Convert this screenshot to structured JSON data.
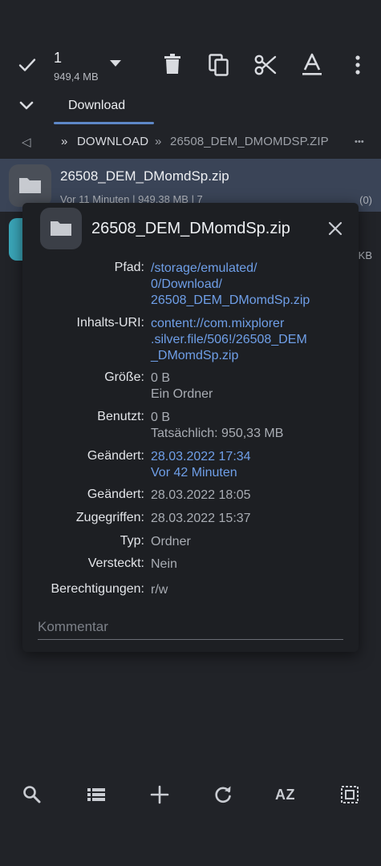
{
  "toolbar": {
    "selected_count": "1",
    "selected_size": "949,4 MB",
    "icons": [
      "check-icon",
      "dropdown-icon",
      "delete-icon",
      "copy-icon",
      "cut-icon",
      "rename-icon",
      "more-icon"
    ]
  },
  "tabs": [
    {
      "label": "Download",
      "active": true
    }
  ],
  "breadcrumb": {
    "back_symbol": "◁",
    "separator1": "»",
    "segment1": "DOWNLOAD",
    "separator2": "»",
    "segment2": "26508_DEM_DMOMDSP.ZIP",
    "overflow": "•••"
  },
  "file_list": {
    "items": [
      {
        "name": "26508_DEM_DMomdSp.zip",
        "meta": "Vor 11 Minuten | 949,38 MB | 7",
        "count": "(0)",
        "selected": true
      },
      {
        "size": "KB"
      }
    ]
  },
  "dialog": {
    "title": "26508_DEM_DMomdSp.zip",
    "rows": {
      "pfad": {
        "label": "Pfad:",
        "lines": [
          "/storage/emulated/",
          "0/Download/",
          "26508_DEM_DMomdSp.zip"
        ]
      },
      "uri": {
        "label": "Inhalts-URI:",
        "lines": [
          "content://com.mixplorer",
          ".silver.file/506!/26508_DEM",
          "_DMomdSp.zip"
        ]
      },
      "groesse": {
        "label": "Größe:",
        "lines": [
          "0 B",
          "Ein Ordner"
        ]
      },
      "benutzt": {
        "label": "Benutzt:",
        "lines": [
          "0 B",
          "Tatsächlich: 950,33 MB"
        ]
      },
      "geaendert1": {
        "label": "Geändert:",
        "lines": [
          "28.03.2022 17:34",
          "Vor 42 Minuten"
        ]
      },
      "geaendert2": {
        "label": "Geändert:",
        "value": "28.03.2022 18:05"
      },
      "zugegriffen": {
        "label": "Zugegriffen:",
        "value": "28.03.2022 15:37"
      },
      "typ": {
        "label": "Typ:",
        "value": "Ordner"
      },
      "versteckt": {
        "label": "Versteckt:",
        "value": "Nein"
      },
      "berechtigungen": {
        "label": "Berechtigungen:",
        "value": "r/w"
      }
    },
    "comment_placeholder": "Kommentar"
  },
  "bottom_bar": {
    "sort_label": "AZ",
    "icons": [
      "search-icon",
      "list-view-icon",
      "add-icon",
      "refresh-icon",
      "sort-icon",
      "select-all-icon"
    ]
  },
  "colors": {
    "background": "#212328",
    "selected_row": "#3a4457",
    "dialog": "#1d1f23",
    "accent": "#5e88c8",
    "link": "#6f9fe8"
  }
}
